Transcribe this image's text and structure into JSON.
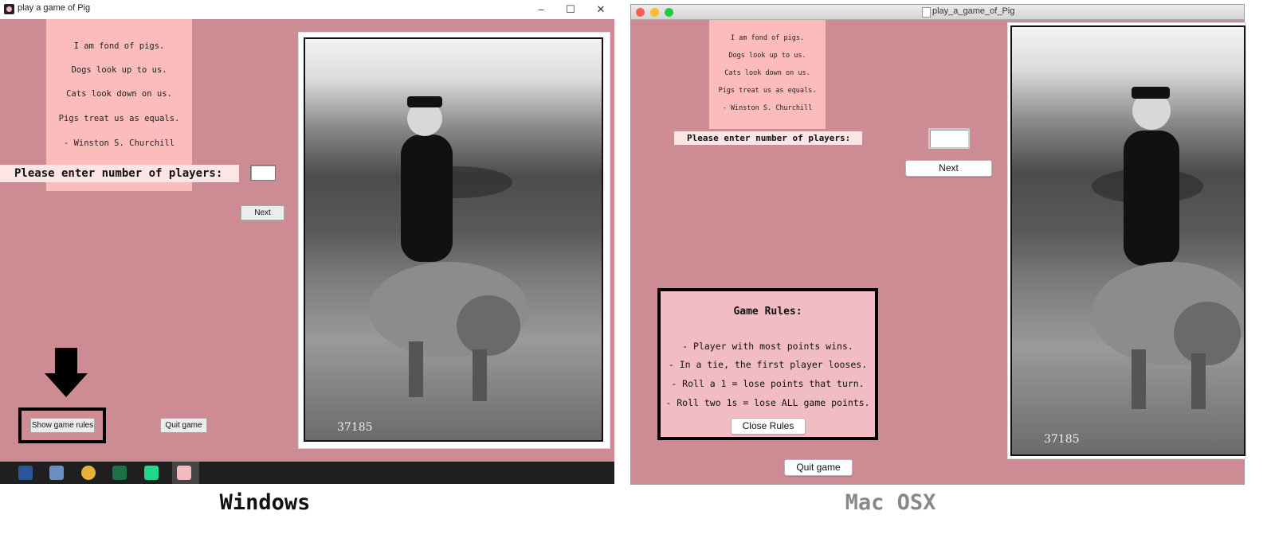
{
  "windows": {
    "window_title": "play a game of Pig",
    "poem": [
      "I am fond of pigs.",
      "Dogs look up to us.",
      "Cats look down on us.",
      "Pigs treat us as equals.",
      "- Winston S. Churchill"
    ],
    "prompt_label": "Please enter number of players:",
    "players_value": "",
    "next_label": "Next",
    "show_rules_label": "Show game rules",
    "quit_label": "Quit game",
    "photo_caption": "37185",
    "caption": "Windows"
  },
  "mac": {
    "window_title": "play_a_game_of_Pig",
    "poem": [
      "I am fond of pigs.",
      "Dogs look up to us.",
      "Cats look down on us.",
      "Pigs treat us as equals.",
      "- Winston S. Churchill"
    ],
    "prompt_label": "Please enter number of players:",
    "players_value": "",
    "next_label": "Next",
    "rules_title": "Game Rules:",
    "rules": [
      "- Player with most points wins.",
      "- In a tie, the first player looses.",
      "- Roll a 1 = lose points that turn.",
      "- Roll two 1s = lose ALL game points."
    ],
    "close_rules_label": "Close Rules",
    "quit_label": "Quit game",
    "photo_caption": "37185",
    "caption": "Mac OSX"
  },
  "colors": {
    "window_bg": "#cd8b94",
    "poem_bg": "#fdbcbc",
    "rules_bg": "#f2bcc4",
    "mac_caption": "#888888"
  }
}
